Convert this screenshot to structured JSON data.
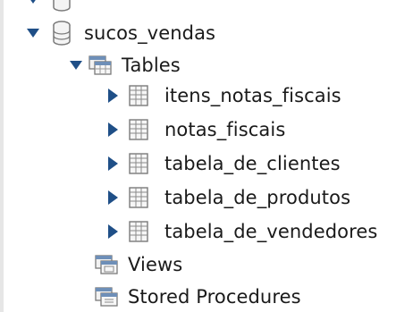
{
  "schema": {
    "name": "sucos_vendas",
    "tables_label": "Tables",
    "tables": [
      "itens_notas_fiscais",
      "notas_fiscais",
      "tabela_de_clientes",
      "tabela_de_produtos",
      "tabela_de_vendedores"
    ],
    "views_label": "Views",
    "procedures_label": "Stored Procedures"
  },
  "icons": {
    "database": "database-icon",
    "folder": "folder-tables-icon",
    "table": "table-icon",
    "expand": "triangle-down-icon",
    "collapse": "triangle-right-icon"
  },
  "colors": {
    "arrow": "#1f4f87",
    "text": "#1a1a1a",
    "icon_gray": "#8a8a8a"
  }
}
